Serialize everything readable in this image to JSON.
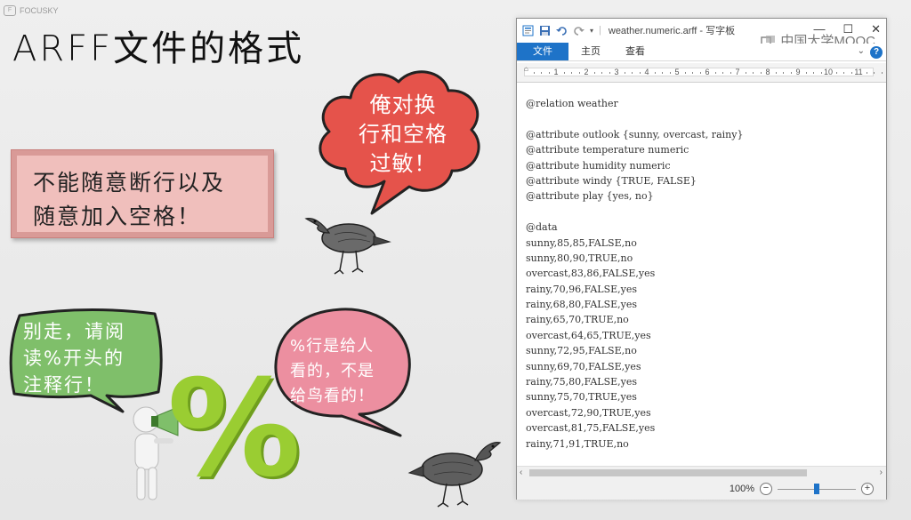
{
  "watermark": {
    "left": "FOCUSKY",
    "mooc": "中国大学MOOC"
  },
  "slide": {
    "title": "ARFF文件的格式",
    "pink_note": [
      "不能随意断行以及",
      "随意加入空格！"
    ],
    "red_cloud": [
      "俺对换",
      "行和空格",
      "过敏！"
    ],
    "green_bubble": [
      "别走，请阅",
      "读%开头的",
      "注释行！"
    ],
    "pink_bubble": [
      "%行是给人",
      "看的，不是",
      "给鸟看的！"
    ],
    "percent_symbol": "%"
  },
  "wordpad": {
    "title": "weather.numeric.arff - 写字板",
    "tabs": [
      "文件",
      "主页",
      "查看"
    ],
    "help": "?",
    "ruler_numbers": [
      "1",
      "2",
      "3",
      "4",
      "5",
      "6",
      "7",
      "8",
      "9",
      "10",
      "11"
    ],
    "document_lines": [
      "@relation weather",
      "",
      "@attribute outlook {sunny, overcast, rainy}",
      "@attribute temperature numeric",
      "@attribute humidity numeric",
      "@attribute windy {TRUE, FALSE}",
      "@attribute play {yes, no}",
      "",
      "@data",
      "sunny,85,85,FALSE,no",
      "sunny,80,90,TRUE,no",
      "overcast,83,86,FALSE,yes",
      "rainy,70,96,FALSE,yes",
      "rainy,68,80,FALSE,yes",
      "rainy,65,70,TRUE,no",
      "overcast,64,65,TRUE,yes",
      "sunny,72,95,FALSE,no",
      "sunny,69,70,FALSE,yes",
      "rainy,75,80,FALSE,yes",
      "sunny,75,70,TRUE,yes",
      "overcast,72,90,TRUE,yes",
      "overcast,81,75,FALSE,yes",
      "rainy,71,91,TRUE,no"
    ],
    "zoom": "100%",
    "zoom_fraction": 0.5
  },
  "colors": {
    "accent": "#1e73c8",
    "pink_note_bg": "#f0bfbc",
    "red_cloud": "#e5534b",
    "green_bubble": "#7fbf6a",
    "pink_bubble": "#ec8fa0",
    "percent_green": "#9acd32"
  }
}
